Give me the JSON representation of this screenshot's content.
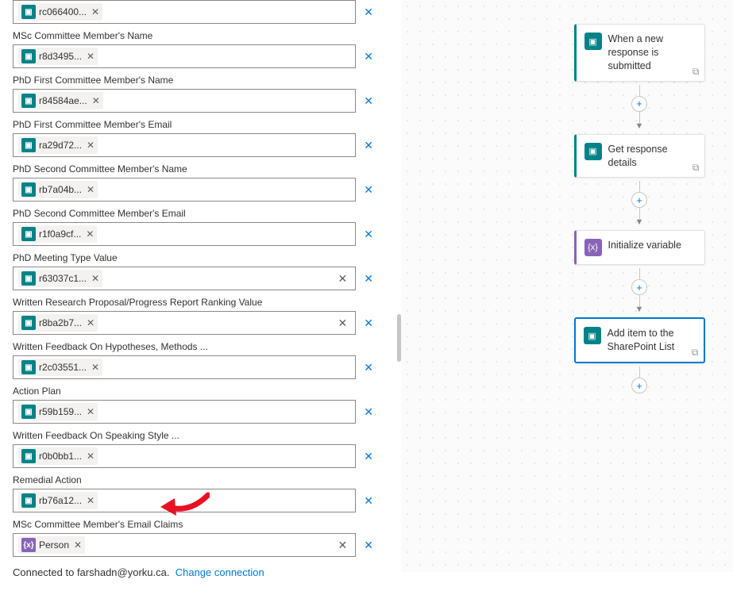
{
  "fields": {
    "msc_name": {
      "label": "MSc Committee Member's Name",
      "token": "r8d3495...",
      "type": "forms"
    },
    "phd1_name": {
      "label": "PhD First Committee Member's Name",
      "token": "r84584ae...",
      "type": "forms"
    },
    "phd1_email": {
      "label": "PhD First Committee Member's Email",
      "token": "ra29d72...",
      "type": "forms"
    },
    "phd2_name": {
      "label": "PhD Second Committee Member's Name",
      "token": "rb7a04b...",
      "type": "forms"
    },
    "phd2_email": {
      "label": "PhD Second Committee Member's Email",
      "token": "r1f0a9cf...",
      "type": "forms"
    },
    "meeting": {
      "label": "PhD Meeting Type Value",
      "token": "r63037c1...",
      "type": "forms"
    },
    "wrp": {
      "label": "Written Research Proposal/Progress Report Ranking Value",
      "token": "r8ba2b7...",
      "type": "forms"
    },
    "wfh": {
      "label": "Written Feedback On Hypotheses, Methods ...",
      "token": "r2c03551...",
      "type": "forms"
    },
    "action": {
      "label": "Action Plan",
      "token": "r59b159...",
      "type": "forms"
    },
    "wfs": {
      "label": "Written Feedback On Speaking Style ...",
      "token": "r0b0bb1...",
      "type": "forms"
    },
    "remedial": {
      "label": "Remedial Action",
      "token": "rb76a12...",
      "type": "forms"
    },
    "msc_claims": {
      "label": "MSc Committee Member's Email Claims",
      "token": "Person",
      "type": "var"
    }
  },
  "top_token": "rc066400...",
  "footer": {
    "text": "Connected to farshadn@yorku.ca.",
    "link": "Change connection"
  },
  "flow": {
    "trigger": "When a new response is submitted",
    "step2": "Get response details",
    "step3": "Initialize variable",
    "step4": "Add item to the SharePoint List"
  },
  "icons": {
    "forms_glyph": "▣",
    "var_glyph": "{x}",
    "link_glyph": "⧉",
    "plus": "+",
    "down": "▼",
    "close": "✕"
  }
}
